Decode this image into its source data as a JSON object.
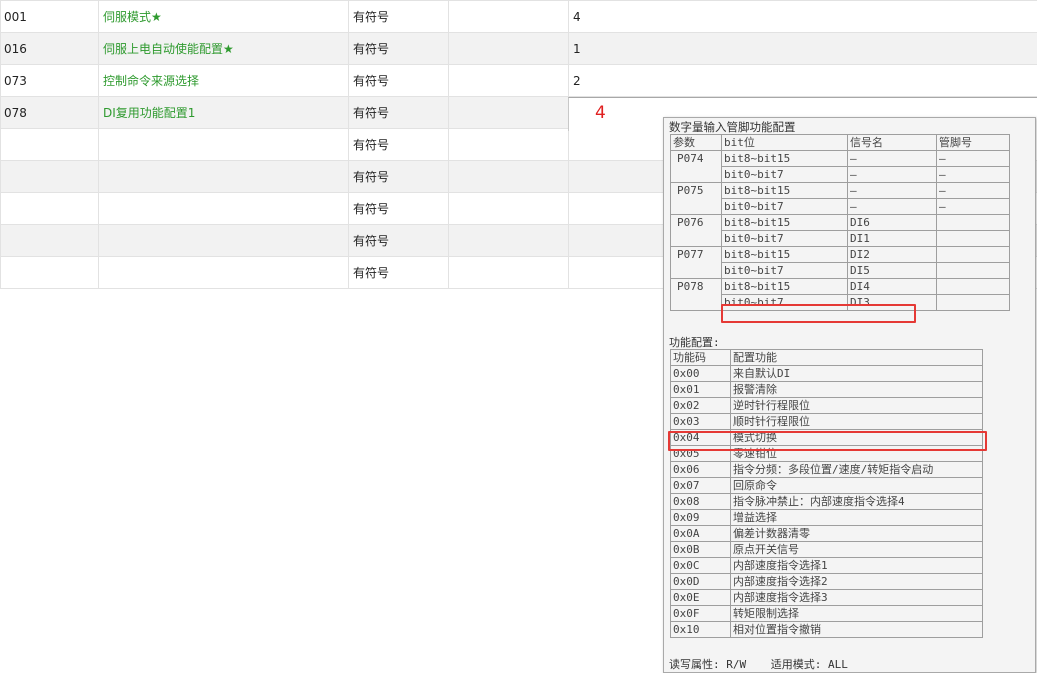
{
  "grid": {
    "rows": [
      {
        "code": "001",
        "name": "伺服模式★",
        "sign": "有符号",
        "blank": "",
        "value": "4"
      },
      {
        "code": "016",
        "name": "伺服上电自动使能配置★",
        "sign": "有符号",
        "blank": "",
        "value": "1"
      },
      {
        "code": "073",
        "name": "控制命令来源选择",
        "sign": "有符号",
        "blank": "",
        "value": "2"
      },
      {
        "code": "078",
        "name": "DI复用功能配置1",
        "sign": "有符号",
        "blank": "",
        "value": ""
      },
      {
        "code": "",
        "name": "",
        "sign": "有符号",
        "blank": "",
        "value": ""
      },
      {
        "code": "",
        "name": "",
        "sign": "有符号",
        "blank": "",
        "value": ""
      },
      {
        "code": "",
        "name": "",
        "sign": "有符号",
        "blank": "",
        "value": ""
      },
      {
        "code": "",
        "name": "",
        "sign": "有符号",
        "blank": "",
        "value": ""
      },
      {
        "code": "",
        "name": "",
        "sign": "有符号",
        "blank": "",
        "value": ""
      }
    ],
    "edit_value": "4"
  },
  "tooltip": {
    "title": "数字量输入管脚功能配置",
    "di_headers": [
      "参数",
      "bit位",
      "信号名",
      "管脚号"
    ],
    "di_rows": [
      {
        "param": "P074",
        "bits": [
          {
            "bit": "bit8~bit15",
            "signal": "—",
            "pin": "—"
          },
          {
            "bit": "bit0~bit7",
            "signal": "—",
            "pin": "—"
          }
        ]
      },
      {
        "param": "P075",
        "bits": [
          {
            "bit": "bit8~bit15",
            "signal": "—",
            "pin": "—"
          },
          {
            "bit": "bit0~bit7",
            "signal": "—",
            "pin": "—"
          }
        ]
      },
      {
        "param": "P076",
        "bits": [
          {
            "bit": "bit8~bit15",
            "signal": "DI6",
            "pin": ""
          },
          {
            "bit": "bit0~bit7",
            "signal": "DI1",
            "pin": ""
          }
        ]
      },
      {
        "param": "P077",
        "bits": [
          {
            "bit": "bit8~bit15",
            "signal": "DI2",
            "pin": ""
          },
          {
            "bit": "bit0~bit7",
            "signal": "DI5",
            "pin": ""
          }
        ]
      },
      {
        "param": "P078",
        "bits": [
          {
            "bit": "bit8~bit15",
            "signal": "DI4",
            "pin": ""
          },
          {
            "bit": "bit0~bit7",
            "signal": "DI3",
            "pin": ""
          }
        ]
      }
    ],
    "func_label": "功能配置:",
    "func_headers": [
      "功能码",
      "配置功能"
    ],
    "func_rows": [
      {
        "code": "0x00",
        "func": "来自默认DI"
      },
      {
        "code": "0x01",
        "func": "报警清除"
      },
      {
        "code": "0x02",
        "func": "逆时针行程限位"
      },
      {
        "code": "0x03",
        "func": "顺时针行程限位"
      },
      {
        "code": "0x04",
        "func": "模式切换"
      },
      {
        "code": "0x05",
        "func": "零速钳位"
      },
      {
        "code": "0x06",
        "func": "指令分频：多段位置/速度/转矩指令启动"
      },
      {
        "code": "0x07",
        "func": "回原命令"
      },
      {
        "code": "0x08",
        "func": "指令脉冲禁止：内部速度指令选择4"
      },
      {
        "code": "0x09",
        "func": "增益选择"
      },
      {
        "code": "0x0A",
        "func": "偏差计数器清零"
      },
      {
        "code": "0x0B",
        "func": "原点开关信号"
      },
      {
        "code": "0x0C",
        "func": "内部速度指令选择1"
      },
      {
        "code": "0x0D",
        "func": "内部速度指令选择2"
      },
      {
        "code": "0x0E",
        "func": "内部速度指令选择3"
      },
      {
        "code": "0x0F",
        "func": "转矩限制选择"
      },
      {
        "code": "0x10",
        "func": "相对位置指令撤销"
      }
    ],
    "footer_rw": "读写属性: R/W",
    "footer_mode": "适用模式: ALL"
  },
  "colors": {
    "name_text": "#2e9a2e",
    "edit_value": "#e02020",
    "highlight": "#e53935",
    "row_alt": "#f2f2f2"
  }
}
